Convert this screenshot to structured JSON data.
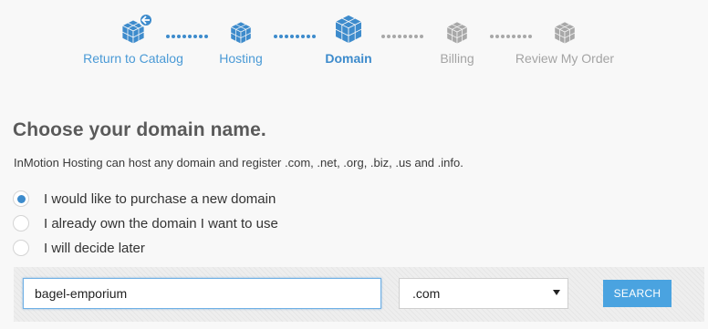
{
  "stepper": {
    "steps": [
      {
        "label": "Return to Catalog",
        "state": "done"
      },
      {
        "label": "Hosting",
        "state": "done"
      },
      {
        "label": "Domain",
        "state": "active"
      },
      {
        "label": "Billing",
        "state": "todo"
      },
      {
        "label": "Review My Order",
        "state": "todo"
      }
    ],
    "icons": [
      "cube-back-icon",
      "cube-icon",
      "cube-icon",
      "cube-icon",
      "cube-icon"
    ]
  },
  "content": {
    "title": "Choose your domain name.",
    "subtitle": "InMotion Hosting can host any domain and register .com, .net, .org, .biz, .us and .info."
  },
  "options": [
    {
      "label": "I would like to purchase a new domain",
      "checked": true
    },
    {
      "label": "I already own the domain I want to use",
      "checked": false
    },
    {
      "label": "I will decide later",
      "checked": false
    }
  ],
  "search": {
    "domain_value": "bagel-emporium",
    "tld_selected": ".com",
    "button_label": "SEARCH"
  },
  "colors": {
    "accent": "#3d8bcc",
    "accent_light": "#4a9ad6",
    "inactive": "#a8a8a8",
    "button": "#4aa3e0"
  }
}
